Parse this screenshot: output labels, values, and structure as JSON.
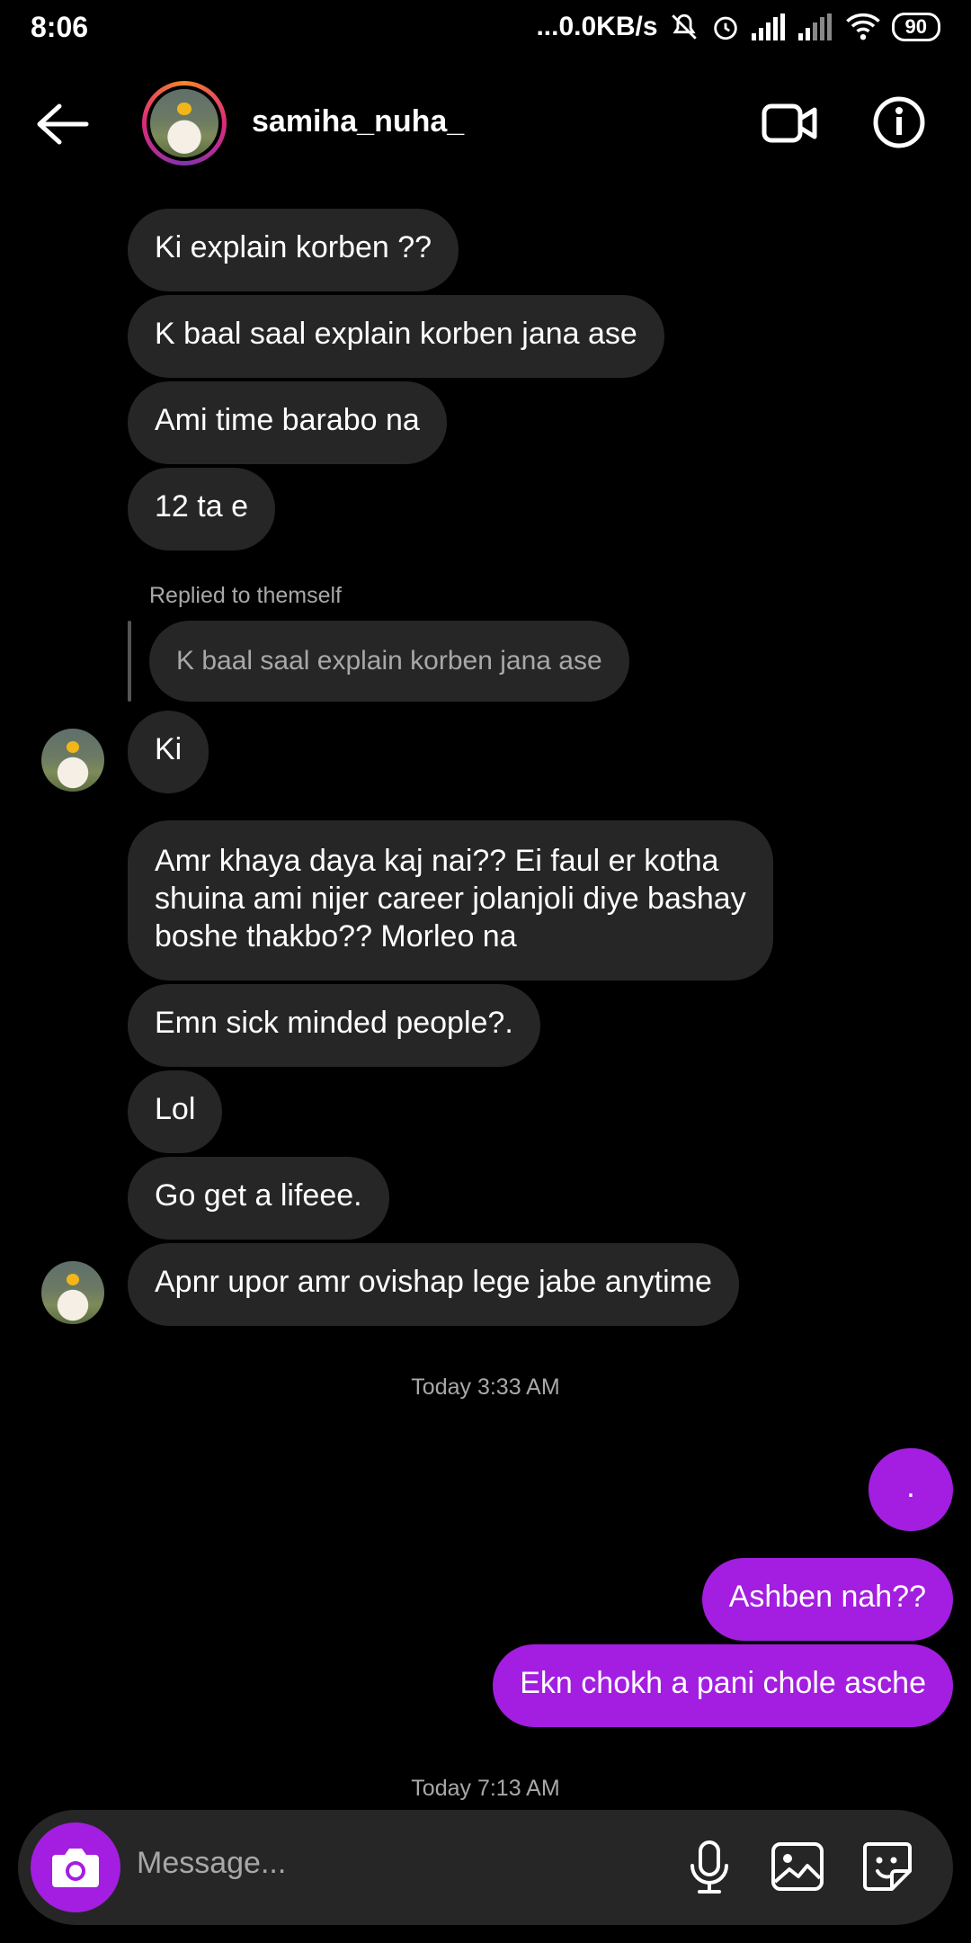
{
  "status_bar": {
    "time": "8:06",
    "network_speed": "...0.0KB/s",
    "battery": "90"
  },
  "header": {
    "username": "samiha_nuha_"
  },
  "messages": {
    "m1": "Ki explain korben ??",
    "m2": "K baal saal explain korben jana ase",
    "m3": "Ami time barabo na",
    "m4": "12 ta e",
    "reply_label": "Replied to themself",
    "reply_quote": "K baal saal explain korben jana ase",
    "m5": "Ki",
    "m6_line1": "Amr khaya daya kaj nai?? Ei faul er kotha",
    "m6_line2": "shuina ami nijer career jolanjoli diye bashay",
    "m6_line3": "boshe thakbo?? Morleo na",
    "m7": "Emn sick minded people?.",
    "m8": "Lol",
    "m9": "Go get a lifeee.",
    "m10": "Apnr upor amr ovishap lege jabe anytime",
    "timestamp1": "Today 3:33 AM",
    "s1": ".",
    "s2": "Ashben nah??",
    "s3": "Ekn chokh a pani chole asche",
    "timestamp2": "Today 7:13 AM"
  },
  "composer": {
    "placeholder": "Message..."
  },
  "colors": {
    "background": "#000000",
    "incoming_bubble": "#262626",
    "outgoing_bubble": "#a31ee0",
    "secondary_text": "#a8a8a8"
  }
}
